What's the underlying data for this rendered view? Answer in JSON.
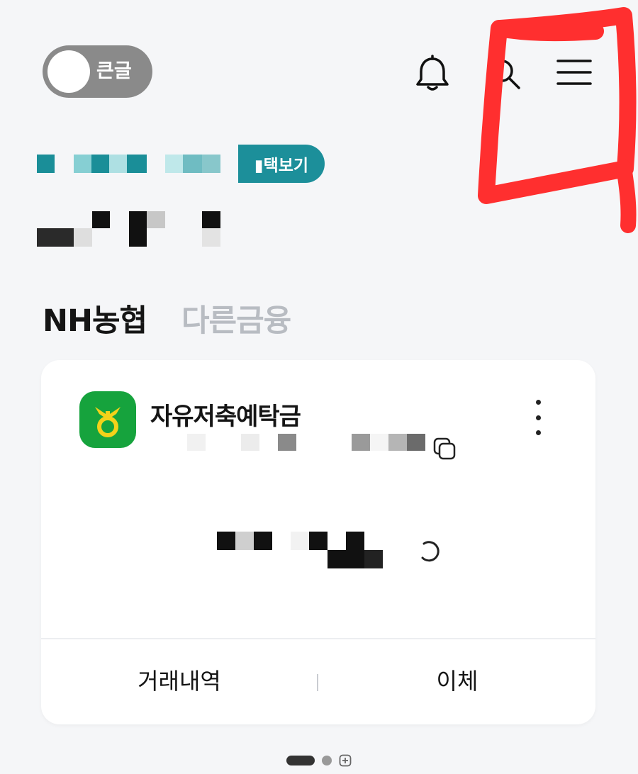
{
  "header": {
    "toggle_label": "큰글",
    "icons": [
      "bell-icon",
      "search-icon",
      "menu-icon"
    ],
    "annotation_color": "#ff2f2f"
  },
  "profile": {
    "view_button_label": "▮택보기"
  },
  "tabs": [
    {
      "label": "NH농협",
      "active": true
    },
    {
      "label": "다른금융",
      "active": false
    }
  ],
  "account_card": {
    "name": "자유저축예탁금",
    "logo_color": "#16a33d",
    "actions": [
      {
        "label": "거래내역"
      },
      {
        "label": "이체"
      }
    ]
  },
  "pager": {
    "pages": 2,
    "current": 1
  }
}
